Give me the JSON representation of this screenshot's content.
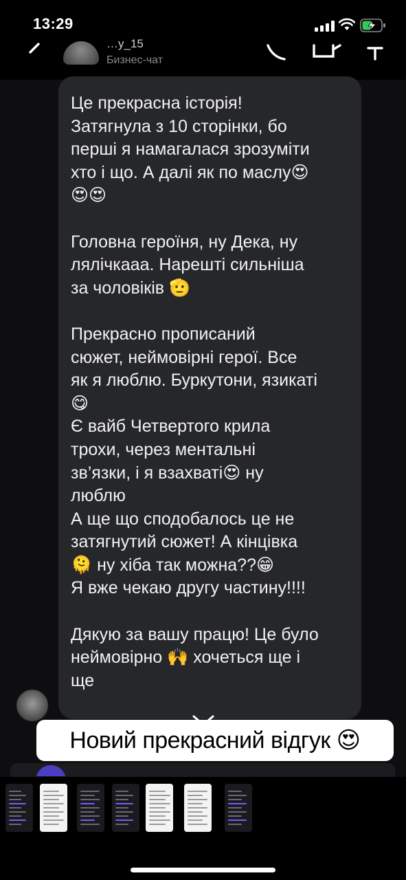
{
  "status_bar": {
    "time": "13:29",
    "battery_charging": true
  },
  "header": {
    "contact_name": "…y_15",
    "contact_subtitle": "Бизнес-чат"
  },
  "message": {
    "text": "Це прекрасна історія!\nЗатягнула з 10 сторінки, бо\nперші я намагалася зрозуміти\nхто і що. А далі як по маслу😍\n😍😍\n\nГоловна героїня, ну Дека, ну\nлялічкааа. Нарешті сильніша\nза чоловіків 🫡\n\nПрекрасно прописаний\nсюжет, неймовірні герої. Все\nяк я люблю. Буркутони, язикаті\n😋\nЄ вайб Четвертого крила\nтрохи, через ментальні\nзв’язки, і я взахваті😍  ну\nлюблю\nА ще що сподобалось це не\nзатягнутий сюжет! А кінцівка\n🫠  ну хіба так можна??😁\nЯ вже чекаю другу частину!!!!\n\nДякую за вашу працю! Це було\nнеймовірно 🙌 хочеться ще і\nще"
  },
  "caption": {
    "text": "Новий прекрасний відгук 😍"
  },
  "colors": {
    "background": "#000000",
    "chat_background": "#0e0e11",
    "bubble": "#26272b",
    "caption_background": "#ffffff",
    "accent_purple": "#4b3ec2"
  },
  "thumbnails": [
    {
      "theme": "dark"
    },
    {
      "theme": "light"
    },
    {
      "theme": "dark"
    },
    {
      "theme": "dark"
    },
    {
      "theme": "light"
    },
    {
      "theme": "light"
    },
    {
      "theme": "dark"
    }
  ]
}
